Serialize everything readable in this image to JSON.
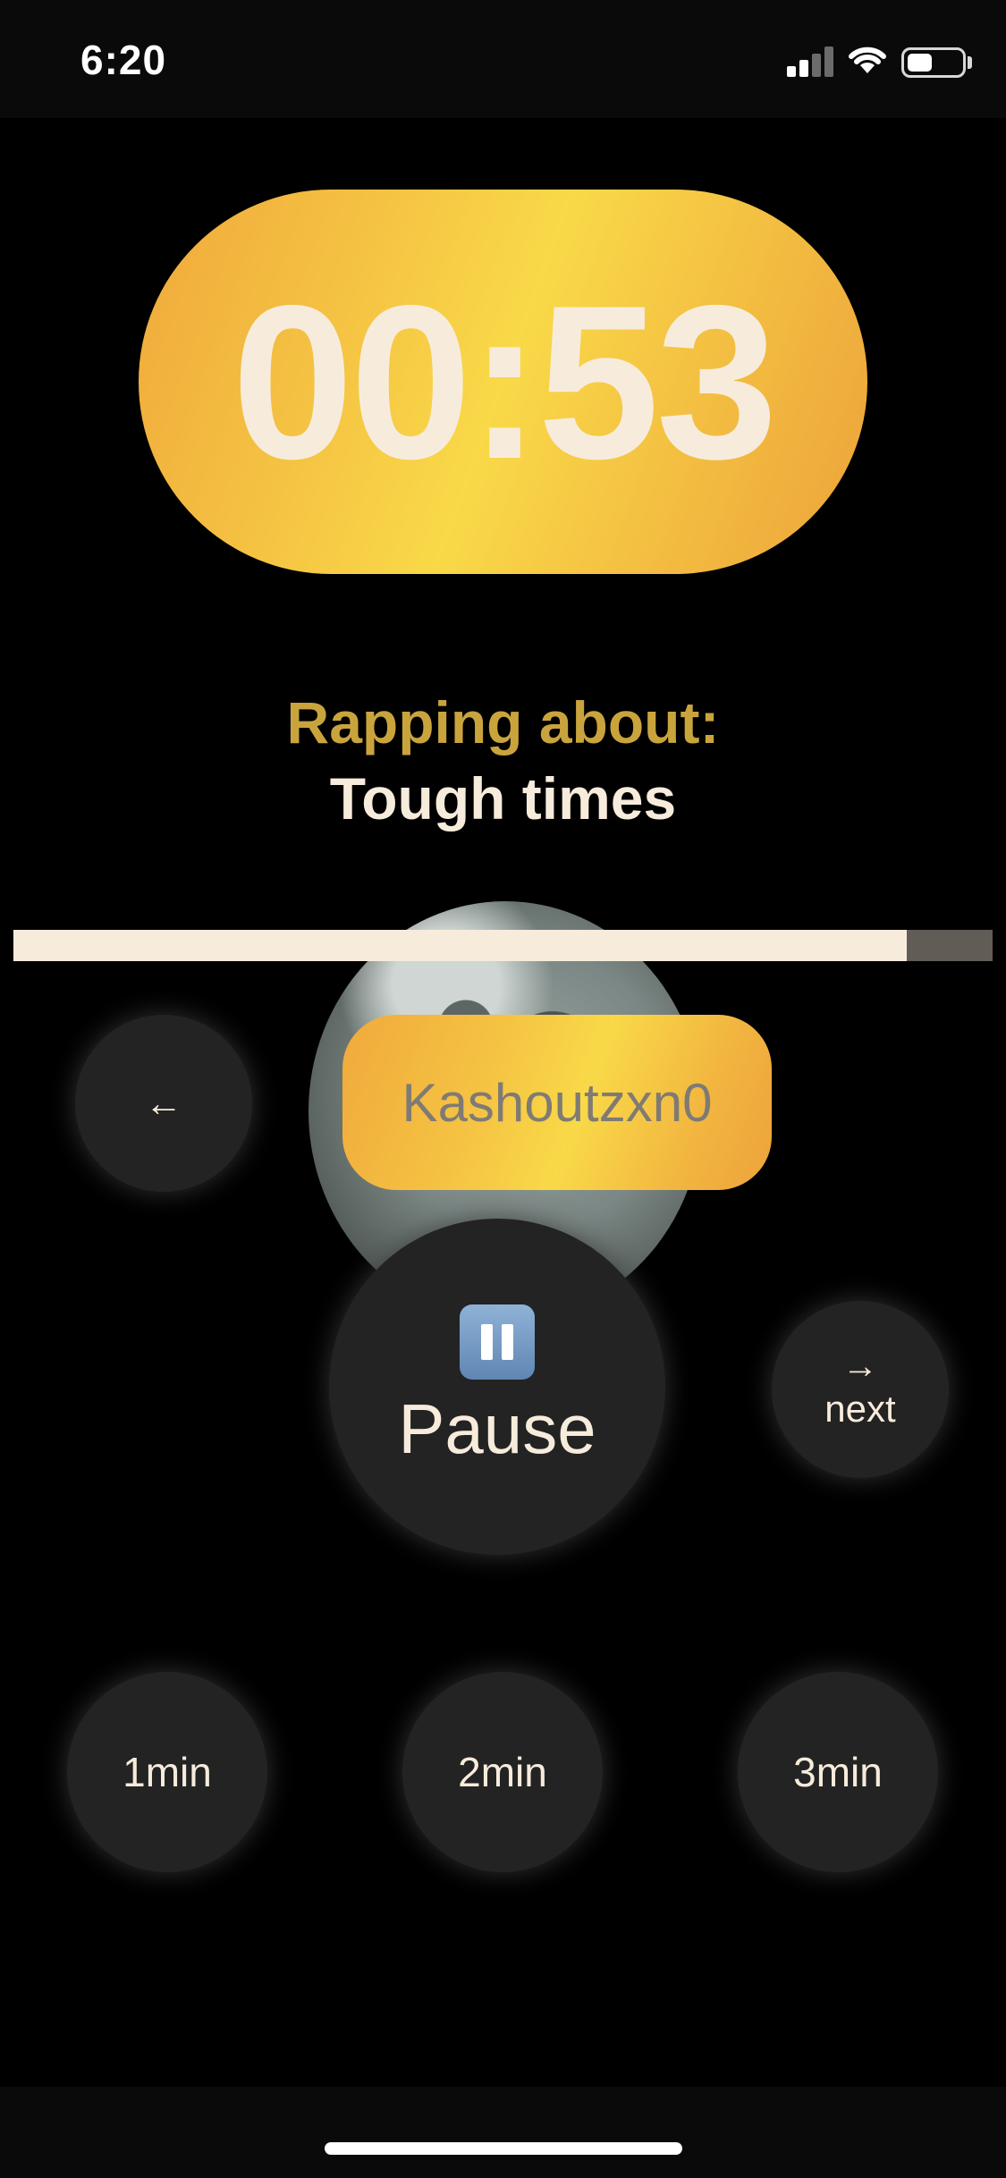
{
  "status_bar": {
    "time": "6:20",
    "signal_bars": 2,
    "battery_level": 0.45
  },
  "timer": {
    "display": "00:53",
    "progress": 0.912
  },
  "topic": {
    "label": "Rapping about:",
    "value": "Tough times"
  },
  "user": {
    "name": "Kashoutzxn0"
  },
  "controls": {
    "back_icon": "←",
    "pause_label": "Pause",
    "next_icon": "→",
    "next_label": "next"
  },
  "durations": [
    {
      "label": "1min"
    },
    {
      "label": "2min"
    },
    {
      "label": "3min"
    }
  ],
  "colors": {
    "accent": "#f5c443",
    "text_cream": "#f7ecdc",
    "topic_gold": "#c9a43d",
    "button_bg": "#232323"
  }
}
